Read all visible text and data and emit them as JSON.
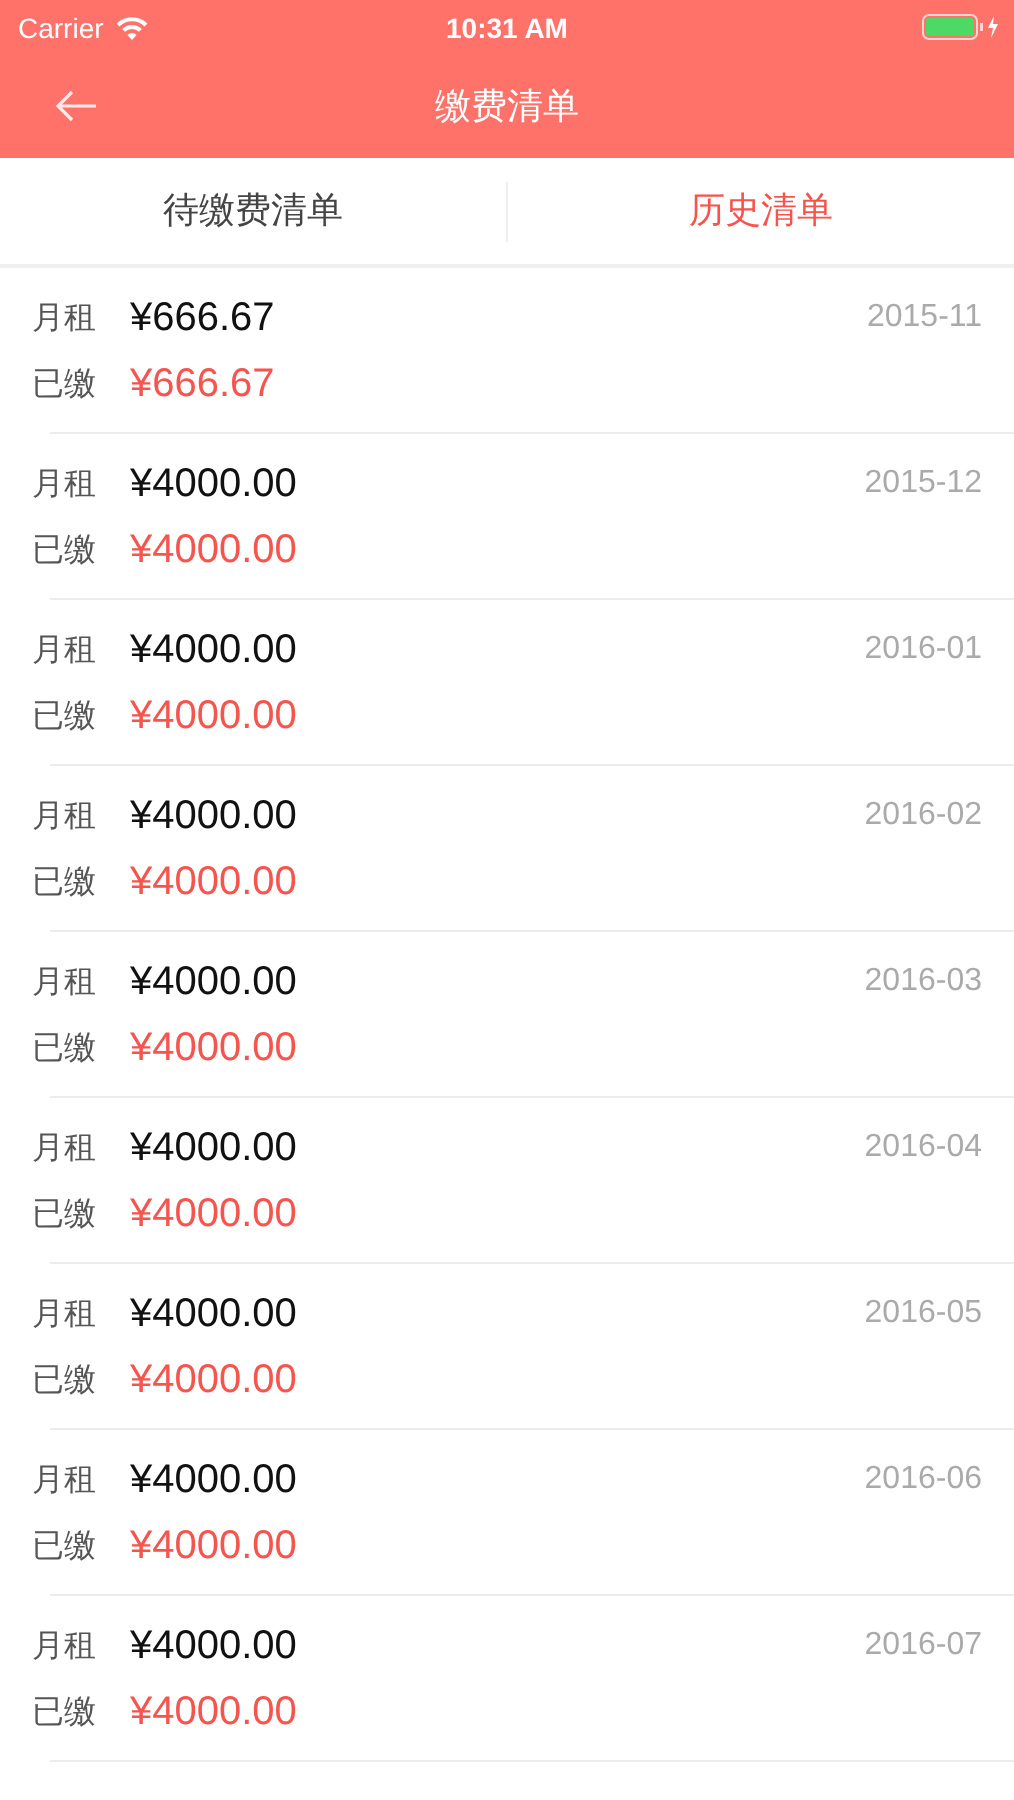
{
  "status_bar": {
    "carrier": "Carrier",
    "time": "10:31 AM"
  },
  "nav": {
    "title": "缴费清单"
  },
  "tabs": [
    {
      "label": "待缴费清单",
      "selected": false
    },
    {
      "label": "历史清单",
      "selected": true
    }
  ],
  "bills": [
    {
      "rent_label": "月租",
      "rent": "¥666.67",
      "month": "2015-11",
      "paid_label": "已缴",
      "paid": "¥666.67"
    },
    {
      "rent_label": "月租",
      "rent": "¥4000.00",
      "month": "2015-12",
      "paid_label": "已缴",
      "paid": "¥4000.00"
    },
    {
      "rent_label": "月租",
      "rent": "¥4000.00",
      "month": "2016-01",
      "paid_label": "已缴",
      "paid": "¥4000.00"
    },
    {
      "rent_label": "月租",
      "rent": "¥4000.00",
      "month": "2016-02",
      "paid_label": "已缴",
      "paid": "¥4000.00"
    },
    {
      "rent_label": "月租",
      "rent": "¥4000.00",
      "month": "2016-03",
      "paid_label": "已缴",
      "paid": "¥4000.00"
    },
    {
      "rent_label": "月租",
      "rent": "¥4000.00",
      "month": "2016-04",
      "paid_label": "已缴",
      "paid": "¥4000.00"
    },
    {
      "rent_label": "月租",
      "rent": "¥4000.00",
      "month": "2016-05",
      "paid_label": "已缴",
      "paid": "¥4000.00"
    },
    {
      "rent_label": "月租",
      "rent": "¥4000.00",
      "month": "2016-06",
      "paid_label": "已缴",
      "paid": "¥4000.00"
    },
    {
      "rent_label": "月租",
      "rent": "¥4000.00",
      "month": "2016-07",
      "paid_label": "已缴",
      "paid": "¥4000.00"
    }
  ]
}
